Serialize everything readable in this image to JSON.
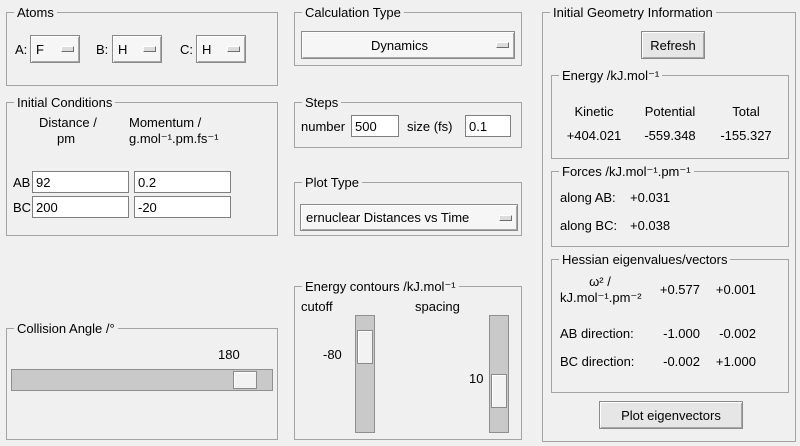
{
  "atoms": {
    "title": "Atoms",
    "a_label": "A:",
    "a_value": "F",
    "b_label": "B:",
    "b_value": "H",
    "c_label": "C:",
    "c_value": "H"
  },
  "initial_conditions": {
    "title": "Initial Conditions",
    "col1_header_line1": "Distance /",
    "col1_header_line2": "pm",
    "col2_header_line1": "Momentum /",
    "col2_header_line2": "g.mol⁻¹.pm.fs⁻¹",
    "rows": [
      {
        "label": "AB",
        "distance": "92",
        "momentum": "0.2"
      },
      {
        "label": "BC",
        "distance": "200",
        "momentum": "-20"
      }
    ]
  },
  "collision_angle": {
    "title": "Collision Angle /°",
    "value": "180"
  },
  "calculation_type": {
    "title": "Calculation Type",
    "value": "Dynamics"
  },
  "steps": {
    "title": "Steps",
    "number_label": "number",
    "number_value": "500",
    "size_label": "size (fs)",
    "size_value": "0.1"
  },
  "plot_type": {
    "title": "Plot Type",
    "value": "ernuclear Distances vs Time"
  },
  "energy_contours": {
    "title": "Energy contours /kJ.mol⁻¹",
    "cutoff_label": "cutoff",
    "cutoff_value": "-80",
    "spacing_label": "spacing",
    "spacing_value": "10"
  },
  "geometry_info": {
    "title": "Initial Geometry Information",
    "refresh_label": "Refresh",
    "energy": {
      "title": "Energy /kJ.mol⁻¹",
      "headers": [
        "Kinetic",
        "Potential",
        "Total"
      ],
      "values": [
        "+404.021",
        "-559.348",
        "-155.327"
      ]
    },
    "forces": {
      "title": "Forces /kJ.mol⁻¹.pm⁻¹",
      "rows": [
        {
          "label": "along AB:",
          "value": "+0.031"
        },
        {
          "label": "along BC:",
          "value": "+0.038"
        }
      ]
    },
    "hessian": {
      "title": "Hessian eigenvalues/vectors",
      "omega_label_line1": "ω² /",
      "omega_label_line2": "kJ.mol⁻¹.pm⁻²",
      "omega_values": [
        "+0.577",
        "+0.001"
      ],
      "rows": [
        {
          "label": "AB direction:",
          "v1": "-1.000",
          "v2": "-0.002"
        },
        {
          "label": "BC direction:",
          "v1": "-0.002",
          "v2": "+1.000"
        }
      ]
    },
    "plot_eigenvectors_label": "Plot eigenvectors"
  }
}
